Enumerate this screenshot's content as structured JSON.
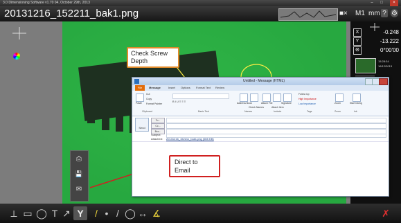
{
  "window": {
    "title": "3.0 Dimensioning Software v1.70 04, October 29th, 2013",
    "minimize_glyph": "–",
    "maximize_glyph": "□",
    "close_glyph": "×"
  },
  "header": {
    "file_name": "20131216_152211_bak1.png",
    "zoom_glyph": "■×",
    "mode_label": "M1",
    "unit_label": "mm",
    "help_glyph": "?",
    "settings_glyph": "⚙"
  },
  "readouts": {
    "x_label": "X",
    "x_value": "-0.248",
    "y_label": "Y",
    "y_value": "-13.222",
    "angle_label": "Θ",
    "angle_value": "0°00'00",
    "time": "15:28:34",
    "date": "16/12/2013"
  },
  "annotations": {
    "check_screw_depth": "Check Screw Depth",
    "direct_to_email": "Direct to Email"
  },
  "email_window": {
    "title": "Untitled - Message (HTML)",
    "file_tab": "File",
    "tabs": [
      "Message",
      "Insert",
      "Options",
      "Format Text",
      "Review"
    ],
    "ribbon": {
      "paste": "Paste",
      "cut": "Cut",
      "copy": "Copy",
      "format_painter": "Format Painter",
      "clipboard_group": "Clipboard",
      "basic_text_group": "Basic Text",
      "address_book": "Address Book",
      "check_names": "Check Names",
      "names_group": "Names",
      "attach_file": "Attach File",
      "attach_item": "Attach Item",
      "signature": "Signature",
      "include_group": "Include",
      "follow_up": "Follow Up",
      "high_importance": "High Importance",
      "low_importance": "Low Importance",
      "tags_group": "Tags",
      "zoom": "Zoom",
      "zoom_group": "Zoom",
      "start_inking": "Start Inking",
      "ink_group": "Ink"
    },
    "send_label": "Send",
    "to_label": "To...",
    "cc_label": "Cc...",
    "bcc_label": "Bcc...",
    "subject_label": "Subject:",
    "attached_label": "Attached:",
    "attachment_name": "20131216_152211_bak1.png (655 KB)"
  },
  "side_panel": {
    "print_glyph": "⎙",
    "save_glyph": "💾",
    "email_glyph": "✉"
  },
  "bottom_toolbar": {
    "tools": [
      {
        "name": "line-measure-tool",
        "glyph": "⟂"
      },
      {
        "name": "rectangle-tool",
        "glyph": "▭"
      },
      {
        "name": "circle-tool",
        "glyph": "◯"
      },
      {
        "name": "text-tool",
        "glyph": "T"
      },
      {
        "name": "arrow-tool",
        "glyph": "↗"
      },
      {
        "name": "calipers-tool",
        "glyph": "Y"
      },
      {
        "name": "pen-tool",
        "glyph": "/"
      },
      {
        "name": "point-tool",
        "glyph": "•"
      },
      {
        "name": "line-tool",
        "glyph": "/"
      },
      {
        "name": "ellipse-tool",
        "glyph": "◯"
      },
      {
        "name": "distance-tool",
        "glyph": "↔"
      },
      {
        "name": "angle-tool",
        "glyph": "∡"
      }
    ],
    "delete_glyph": "✗"
  }
}
